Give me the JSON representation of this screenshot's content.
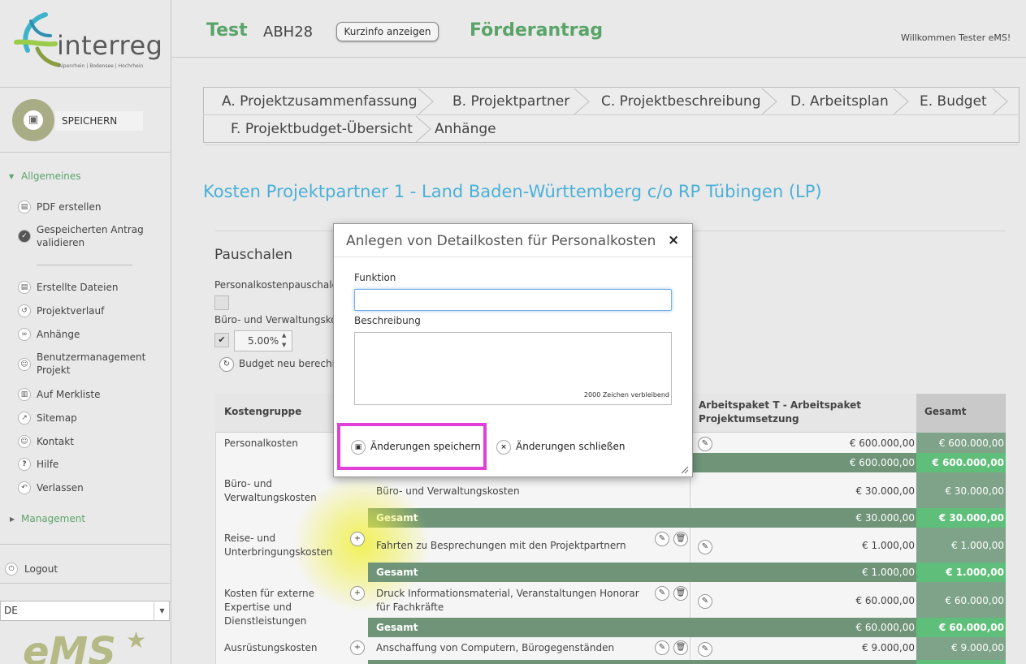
{
  "sidebar": {
    "logo_text": "interreg",
    "logo_subtitle": "Alpenrhein | Bodensee | Hochrhein",
    "save_label": "SPEICHERN",
    "section_general": "Allgemeines",
    "items": [
      {
        "label": "PDF erstellen",
        "icon": "pdf-icon"
      },
      {
        "label": "Gespeicherten Antrag validieren",
        "icon": "check-icon"
      },
      {
        "label": "Erstellte Dateien",
        "icon": "files-icon"
      },
      {
        "label": "Projektverlauf",
        "icon": "history-icon"
      },
      {
        "label": "Anhänge",
        "icon": "attachment-icon"
      },
      {
        "label": "Benutzermanagement Projekt",
        "icon": "user-management-icon"
      },
      {
        "label": "Auf Merkliste",
        "icon": "bookmark-icon"
      },
      {
        "label": "Sitemap",
        "icon": "sitemap-icon"
      },
      {
        "label": "Kontakt",
        "icon": "contact-icon"
      },
      {
        "label": "Hilfe",
        "icon": "help-icon"
      },
      {
        "label": "Verlassen",
        "icon": "exit-icon"
      }
    ],
    "section_management": "Management",
    "logout": "Logout",
    "language": "DE",
    "bottom_logo": "eMS"
  },
  "header": {
    "project_name": "Test",
    "project_code": "ABH28",
    "kurzinfo_button": "Kurzinfo anzeigen",
    "form_title": "Förderantrag",
    "welcome": "Willkommen Tester eMS!"
  },
  "tabs": [
    "A. Projektzusammenfassung",
    "B. Projektpartner",
    "C. Projektbeschreibung",
    "D. Arbeitsplan",
    "E. Budget",
    "F. Projektbudget-Übersicht",
    "Anhänge"
  ],
  "page": {
    "title": "Kosten Projektpartner 1 - Land Baden-Württemberg c/o RP Tübingen (LP)",
    "pauschalen": "Pauschalen",
    "personal_pauschale": "Personalkostenpauschale",
    "buero_label": "Büro- und Verwaltungskos",
    "rate_value": "5.00%",
    "recalc": "Budget neu berechne"
  },
  "table": {
    "headers": {
      "kostengruppe": "Kostengruppe",
      "arbeitspaket": "Arbeitspaket T - Arbeitspaket Projektumsetzung",
      "gesamt": "Gesamt"
    },
    "rows": [
      {
        "group": "Personalkosten",
        "desc": "",
        "ap": "€ 600.000,00",
        "total": "€ 600.000,00",
        "sum_ap": "€ 600.000,00",
        "sum_total": "€ 600.000,00"
      },
      {
        "group": "Büro- und Verwaltungskosten",
        "desc": "Büro- und Verwaltungskosten",
        "ap": "€ 30.000,00",
        "total": "€ 30.000,00",
        "sum_ap": "€ 30.000,00",
        "sum_total": "€ 30.000,00"
      },
      {
        "group": "Reise- und Unterbringungskosten",
        "desc": "Fahrten zu Besprechungen mit den Projektpartnern",
        "ap": "€ 1.000,00",
        "total": "€ 1.000,00",
        "sum_ap": "€ 1.000,00",
        "sum_total": "€ 1.000,00"
      },
      {
        "group": "Kosten für externe Expertise und Dienstleistungen",
        "desc": "Druck Informationsmaterial, Veranstaltungen Honorar für Fachkräfte",
        "ap": "€ 60.000,00",
        "total": "€ 60.000,00",
        "sum_ap": "€ 60.000,00",
        "sum_total": "€ 60.000,00"
      },
      {
        "group": "Ausrüstungskosten",
        "desc": "Anschaffung von Computern, Bürogegenständen",
        "ap": "€ 9.000,00",
        "total": "€ 9.000,00"
      }
    ],
    "gesamt_label": "Gesamt"
  },
  "modal": {
    "title": "Anlegen von Detailkosten für Personalkosten",
    "close_icon": "×",
    "funktion_label": "Funktion",
    "funktion_value": "",
    "beschreibung_label": "Beschreibung",
    "beschreibung_value": "",
    "chars_left": "2000 Zeichen verbleibend",
    "save_button": "Änderungen speichern",
    "close_button": "Änderungen schließen"
  }
}
